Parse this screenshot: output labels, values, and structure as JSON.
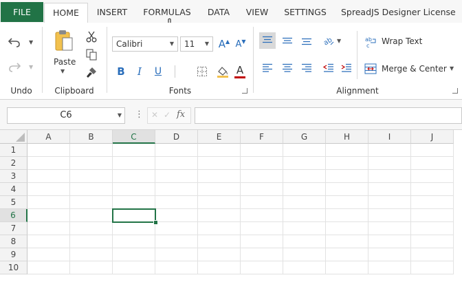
{
  "tabs": [
    {
      "label": "FILE"
    },
    {
      "label": "HOME"
    },
    {
      "label": "INSERT"
    },
    {
      "label": "FORMULAS"
    },
    {
      "label": "DATA"
    },
    {
      "label": "VIEW"
    },
    {
      "label": "SETTINGS"
    },
    {
      "label": "SpreadJS Designer License"
    }
  ],
  "active_tab": "HOME",
  "accent_color": "#217346",
  "ribbon": {
    "undo_group": {
      "label": "Undo",
      "icons": [
        "undo-icon",
        "redo-icon"
      ]
    },
    "clipboard_group": {
      "label": "Clipboard",
      "paste_label": "Paste",
      "icons": [
        "paste-icon",
        "cut-icon",
        "copy-icon",
        "format-painter-icon"
      ]
    },
    "fonts_group": {
      "label": "Fonts",
      "font_name": "Calibri",
      "font_size": "11",
      "bold_glyph": "B",
      "italic_glyph": "I",
      "underline_glyph": "U",
      "grow_glyph": "A",
      "shrink_glyph": "A",
      "font_color_glyph": "A",
      "icons": [
        "increase-font-icon",
        "decrease-font-icon",
        "borders-icon",
        "fill-color-icon",
        "font-color-icon"
      ]
    },
    "alignment_group": {
      "label": "Alignment",
      "wrap_text_label": "Wrap Text",
      "merge_center_label": "Merge & Center",
      "icons": [
        "align-top-icon",
        "align-middle-icon",
        "align-bottom-icon",
        "orientation-icon",
        "align-left-icon",
        "align-center-icon",
        "align-right-icon",
        "decrease-indent-icon",
        "increase-indent-icon",
        "wrap-text-icon",
        "merge-center-icon"
      ]
    }
  },
  "formula_bar": {
    "name_box": "C6",
    "cancel_glyph": "✕",
    "confirm_glyph": "✓",
    "fx_label": "fx",
    "more_glyph": "⋮",
    "formula": ""
  },
  "grid": {
    "columns": [
      "A",
      "B",
      "C",
      "D",
      "E",
      "F",
      "G",
      "H",
      "I",
      "J"
    ],
    "rows": [
      "1",
      "2",
      "3",
      "4",
      "5",
      "6",
      "7",
      "8",
      "9",
      "10"
    ],
    "selected_column": "C",
    "selected_row": "6",
    "active_cell": "C6"
  }
}
